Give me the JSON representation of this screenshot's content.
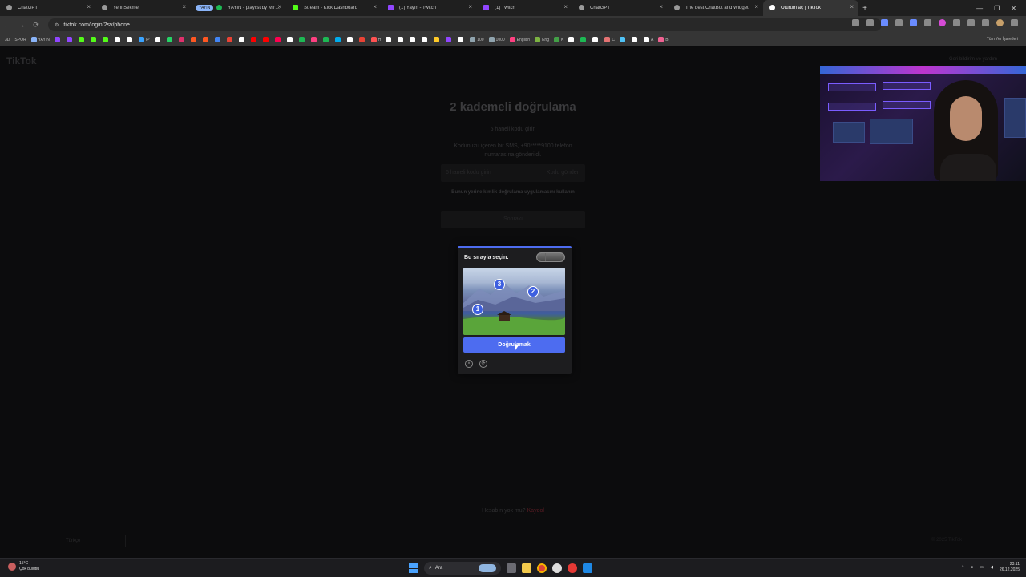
{
  "tabs": [
    {
      "title": "ChatGPT",
      "fav": ""
    },
    {
      "title": "Yeni Sekme",
      "fav": ""
    },
    {
      "title": "YAYIN - playlist by Mironicteri",
      "fav": "spot",
      "group": "YAYIN"
    },
    {
      "title": "Stream - Kick Dashboard",
      "fav": "kick"
    },
    {
      "title": "(1) Yayın - Twitch",
      "fav": "twitch"
    },
    {
      "title": "(1) Twitch",
      "fav": "twitch"
    },
    {
      "title": "ChatGPT",
      "fav": ""
    },
    {
      "title": "The best ChatBot and Widget",
      "fav": ""
    },
    {
      "title": "Oturum aç | TikTok",
      "fav": "tt",
      "active": true
    }
  ],
  "browser": {
    "url": "tiktok.com/login/2sv/phone",
    "all_bookmarks": "Tüm Yer İşaretleri"
  },
  "bookmarks": [
    {
      "label": "3D",
      "color": ""
    },
    {
      "label": "SPOR",
      "color": ""
    },
    {
      "label": "YAYIN",
      "color": "#8ab4f8"
    },
    {
      "label": "",
      "color": "#9146ff"
    },
    {
      "label": "",
      "color": "#9146ff"
    },
    {
      "label": "",
      "color": "#53fc18"
    },
    {
      "label": "",
      "color": "#53fc18"
    },
    {
      "label": "",
      "color": "#53fc18"
    },
    {
      "label": "",
      "color": "#ffffff"
    },
    {
      "label": "",
      "color": "#ffffff"
    },
    {
      "label": "IP",
      "color": "#3aa3ff"
    },
    {
      "label": "",
      "color": "#ffffff"
    },
    {
      "label": "",
      "color": "#25d366"
    },
    {
      "label": "",
      "color": "#e1306c"
    },
    {
      "label": "",
      "color": "#ff5722"
    },
    {
      "label": "",
      "color": "#ff5722"
    },
    {
      "label": "",
      "color": "#4285f4"
    },
    {
      "label": "",
      "color": "#ea4335"
    },
    {
      "label": "",
      "color": "#ffffff"
    },
    {
      "label": "",
      "color": "#ff0000"
    },
    {
      "label": "",
      "color": "#ff0000"
    },
    {
      "label": "",
      "color": "#ff0050"
    },
    {
      "label": "",
      "color": "#ffffff"
    },
    {
      "label": "",
      "color": "#1db954"
    },
    {
      "label": "",
      "color": "#ff4081"
    },
    {
      "label": "",
      "color": "#1db954"
    },
    {
      "label": "",
      "color": "#00aced"
    },
    {
      "label": "",
      "color": "#ffffff"
    },
    {
      "label": "",
      "color": "#ea4335"
    },
    {
      "label": "H",
      "color": "#ff5252"
    },
    {
      "label": "",
      "color": "#ffffff"
    },
    {
      "label": "",
      "color": "#ffffff"
    },
    {
      "label": "",
      "color": "#ffffff"
    },
    {
      "label": "",
      "color": "#ffffff"
    },
    {
      "label": "",
      "color": "#ffca28"
    },
    {
      "label": "",
      "color": "#9146ff"
    },
    {
      "label": "",
      "color": "#ffffff"
    },
    {
      "label": "100",
      "color": "#90a4ae"
    },
    {
      "label": "1000",
      "color": "#90a4ae"
    },
    {
      "label": "English",
      "color": "#ff4081"
    },
    {
      "label": "Eng",
      "color": "#7cb342"
    },
    {
      "label": "K",
      "color": "#43a047"
    },
    {
      "label": "",
      "color": "#ffffff"
    },
    {
      "label": "",
      "color": "#1db954"
    },
    {
      "label": "",
      "color": "#ffffff"
    },
    {
      "label": "C",
      "color": "#e57373"
    },
    {
      "label": "",
      "color": "#4fc3f7"
    },
    {
      "label": "",
      "color": "#ffffff"
    },
    {
      "label": "A",
      "color": "#ffffff"
    },
    {
      "label": "B",
      "color": "#f06292"
    }
  ],
  "page": {
    "logo": "TikTok",
    "feedback": "Geri bildirim ve yardım",
    "title": "2 kademeli doğrulama",
    "subtitle": "6 haneli kodu girin",
    "desc": "Kodunuzu içeren bir SMS, +90*****9100 telefon numarasına gönderildi.",
    "code_placeholder": "6 haneli kodu girin",
    "send_code": "Kodu gönder",
    "alt_link": "Bunun yerine kimlik doğrulama uygulamasını kullanın",
    "submit": "Sonraki",
    "signup_q": "Hesabın yok mu?",
    "signup_link": "Kaydol",
    "language": "Türkçe",
    "copyright": "© 2025 TikTok"
  },
  "captcha": {
    "prompt": "Bu sırayla seçin:",
    "verify": "Doğrulamak",
    "markers": [
      "1",
      "2",
      "3"
    ],
    "close_icon": "×",
    "refresh_icon": "⟳"
  },
  "taskbar": {
    "temp": "15°C",
    "weather": "Çok bulutlu",
    "search": "Ara",
    "time": "23:11",
    "date": "26.12.2025"
  },
  "colors": {
    "accent": "#4d6cf0",
    "signup_link": "#5a1c24"
  }
}
